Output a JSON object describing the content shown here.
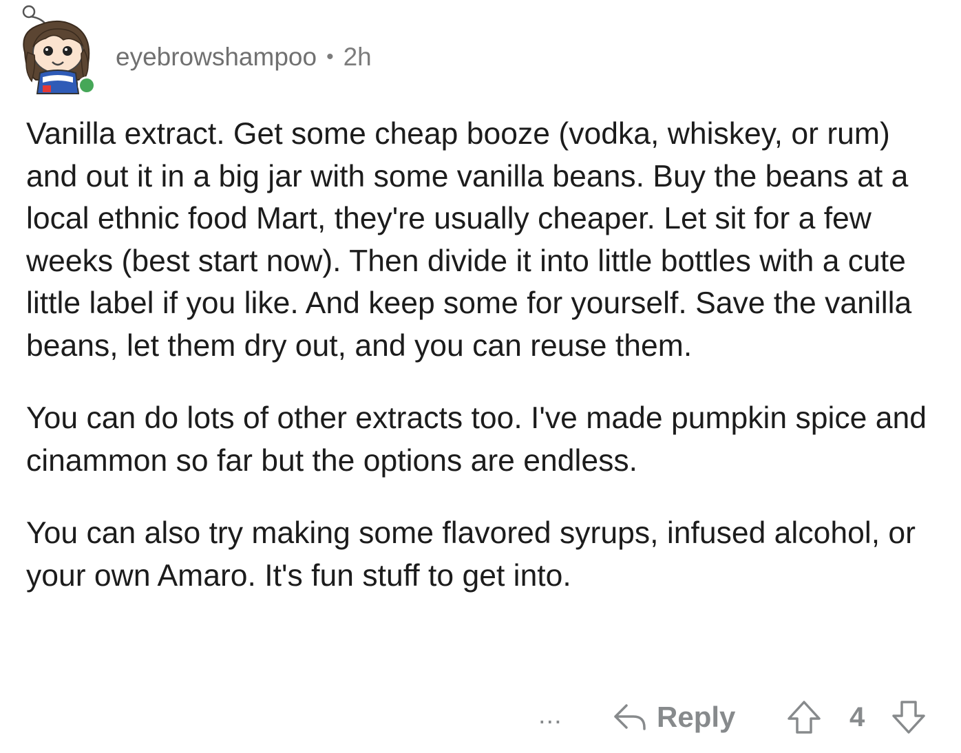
{
  "comment": {
    "username": "eyebrowshampoo",
    "separator": "•",
    "age": "2h",
    "avatar": {
      "icon": "snoo-avatar-icon",
      "online_indicator_color": "#46a758"
    },
    "paragraphs": [
      "Vanilla extract. Get some cheap booze (vodka, whiskey, or rum) and out it in a big jar with some vanilla beans. Buy the beans at a local ethnic food Mart, they're usually cheaper. Let sit for a few weeks (best start now). Then divide it into little bottles with a cute little label if you like. And keep some for yourself. Save the vanilla beans, let them dry out, and you can reuse them.",
      "You can do lots of other extracts too. I've made pumpkin spice and cinammon so far but the options are endless.",
      "You can also try making some flavored syrups, infused alcohol, or your own Amaro. It's fun stuff to get into."
    ]
  },
  "actions": {
    "more_label": "...",
    "reply_label": "Reply",
    "reply_icon": "reply-arrow-icon",
    "upvote_icon": "upvote-arrow-icon",
    "score": "4",
    "downvote_icon": "downvote-arrow-icon"
  },
  "colors": {
    "meta_text": "#7c7c7c",
    "action_gray": "#878a8c",
    "body_text": "#1c1c1c"
  }
}
